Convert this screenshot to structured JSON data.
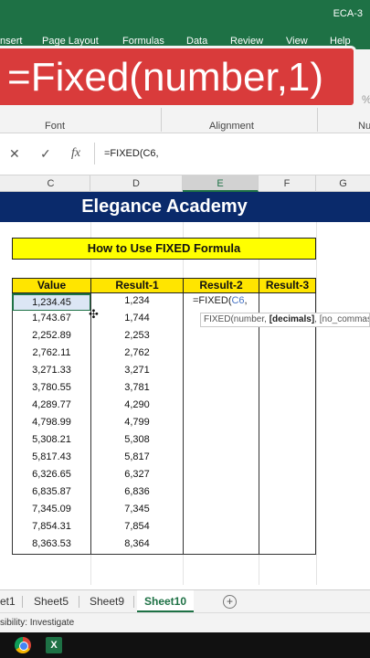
{
  "window": {
    "title": "ECA-3"
  },
  "menu": {
    "items": [
      "nsert",
      "Page Layout",
      "Formulas",
      "Data",
      "Review",
      "View",
      "Help"
    ]
  },
  "banner": {
    "text": "=Fixed(number,1)"
  },
  "ribbon": {
    "groups": [
      "Font",
      "Alignment",
      "Nu"
    ],
    "percent_symbol": "%"
  },
  "formula_bar": {
    "cancel_icon": "✕",
    "enter_icon": "✓",
    "fx_icon": "fx",
    "content": "=FIXED(C6,"
  },
  "columns": [
    "C",
    "D",
    "E",
    "F",
    "G"
  ],
  "sheet": {
    "academy_title": "Elegance Academy",
    "subtitle": "How to Use FIXED Formula",
    "headers": [
      "Value",
      "Result-1",
      "Result-2",
      "Result-3"
    ],
    "values": [
      "1,234.45",
      "1,743.67",
      "2,252.89",
      "2,762.11",
      "3,271.33",
      "3,780.55",
      "4,289.77",
      "4,798.99",
      "5,308.21",
      "5,817.43",
      "6,326.65",
      "6,835.87",
      "7,345.09",
      "7,854.31",
      "8,363.53"
    ],
    "result1": [
      "1,234",
      "1,744",
      "2,253",
      "2,762",
      "3,271",
      "3,781",
      "4,290",
      "4,799",
      "5,308",
      "5,817",
      "6,327",
      "6,836",
      "7,345",
      "7,854",
      "8,364"
    ],
    "editing_cell": {
      "prefix": "=FIXED(",
      "ref": "C6",
      "suffix": ","
    }
  },
  "tooltip": {
    "fn": "FIXED(number, ",
    "bold_arg": "[decimals]",
    "rest": ", [no_commas])"
  },
  "sheet_tabs": {
    "items": [
      "et1",
      "Sheet5",
      "Sheet9",
      "Sheet10"
    ],
    "active": "Sheet10",
    "add_icon": "+"
  },
  "status": {
    "text": "sibility: Investigate"
  },
  "taskbar": {
    "excel_label": "X"
  }
}
